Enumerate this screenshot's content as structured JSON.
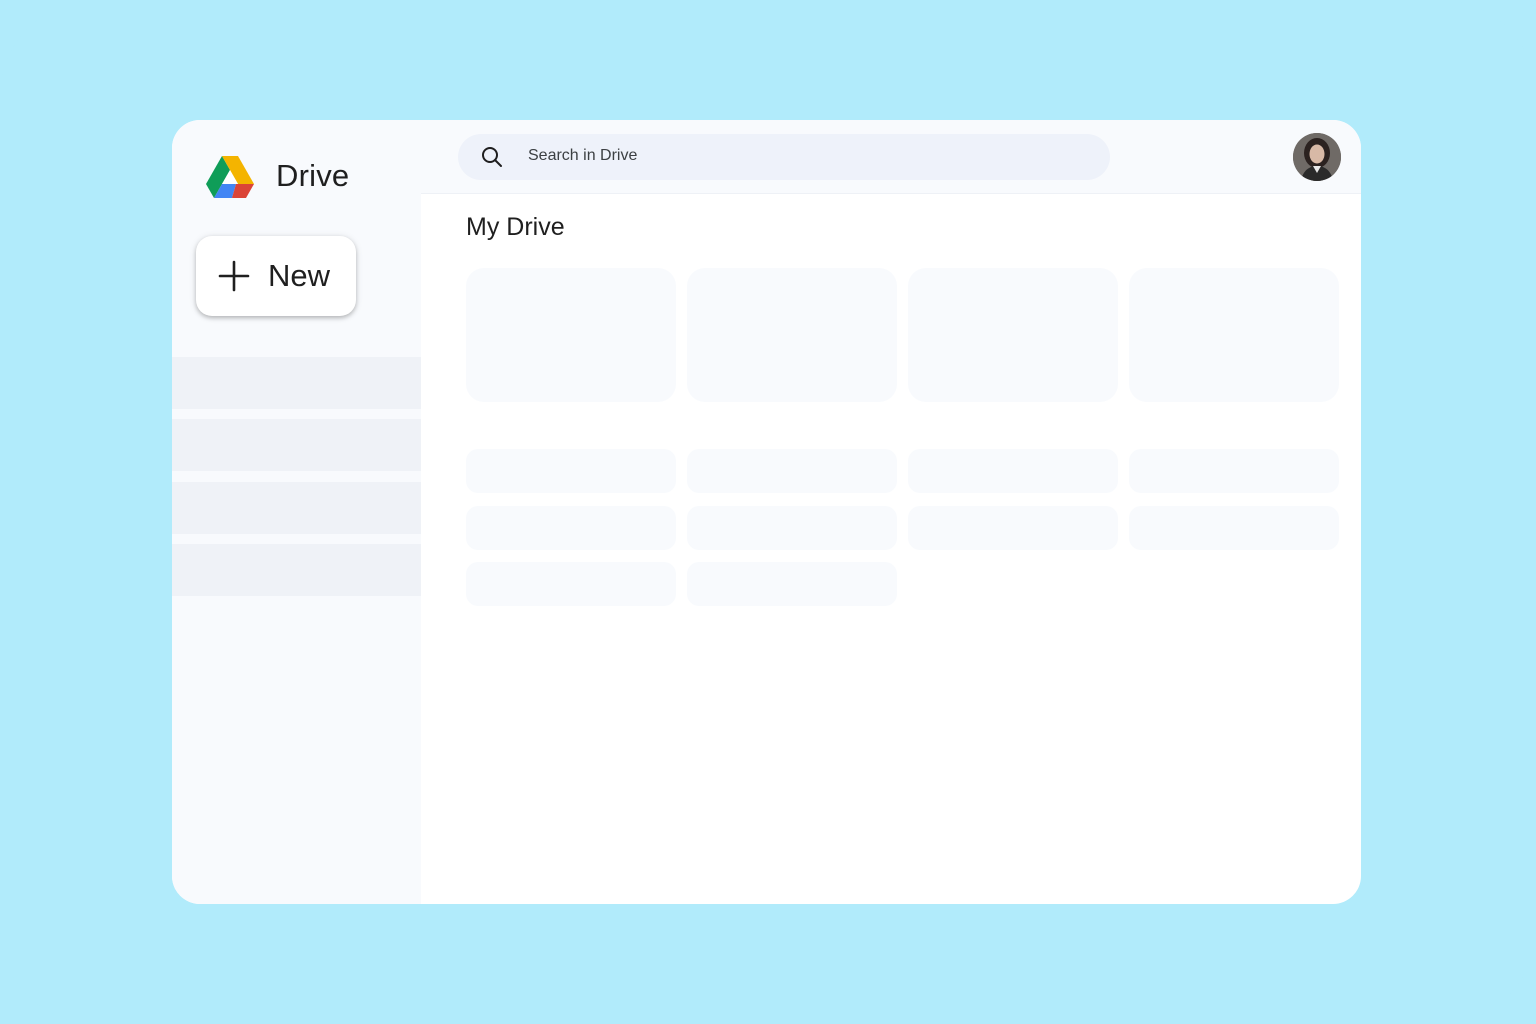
{
  "app": {
    "name": "Drive",
    "logo_icon": "google-drive-logo-icon"
  },
  "actions": {
    "new_label": "New"
  },
  "search": {
    "placeholder": "Search in Drive",
    "icon": "search-icon"
  },
  "main": {
    "title": "My Drive"
  },
  "colors": {
    "background": "#b1ebfb",
    "sidebar": "#f8fafd",
    "placeholder_block": "#f8fafd",
    "nav_block": "#eff2f7",
    "drive_green": "#0f9d58",
    "drive_yellow": "#f4b400",
    "drive_blue": "#4285f4",
    "drive_red": "#db4437"
  }
}
